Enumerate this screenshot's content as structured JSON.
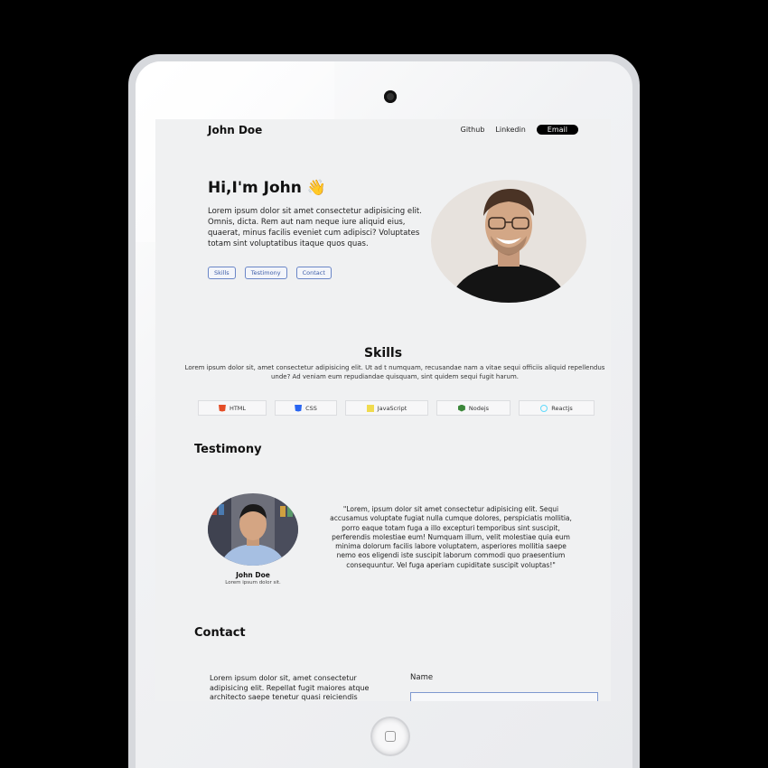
{
  "header": {
    "brand": "John Doe",
    "nav": [
      "Github",
      "Linkedin",
      "Email"
    ]
  },
  "hero": {
    "title": "Hi,I'm John 👋",
    "text": "Lorem ipsum dolor sit amet consectetur adipisicing elit. Omnis, dicta. Rem aut nam neque iure aliquid eius, quaerat, minus facilis eveniet cum adipisci? Voluptates totam sint voluptatibus itaque quos quas.",
    "buttons": [
      "Skills",
      "Testimony",
      "Contact"
    ]
  },
  "skills": {
    "title": "Skills",
    "description": "Lorem ipsum dolor sit, amet consectetur adipisicing elit. Ut ad t numquam, recusandae nam a vitae sequi officiis aliquid repellendus unde? Ad veniam eum repudiandae quisquam, sint quidem sequi fugit harum.",
    "items": [
      {
        "label": "HTML",
        "icon": "html5-icon",
        "color": "#e44d26"
      },
      {
        "label": "CSS",
        "icon": "css3-icon",
        "color": "#2965f1"
      },
      {
        "label": "JavaScript",
        "icon": "javascript-icon",
        "color": "#f0db4f"
      },
      {
        "label": "Nodejs",
        "icon": "nodejs-icon",
        "color": "#3c873a"
      },
      {
        "label": "Reactjs",
        "icon": "react-icon",
        "color": "#61dafb"
      }
    ]
  },
  "testimony": {
    "title": "Testimony",
    "name": "John Doe",
    "role": "Lorem ipsum dolor sit.",
    "quote": "\"Lorem, ipsum dolor sit amet consectetur adipisicing elit. Sequi accusamus voluptate fugiat nulla cumque dolores, perspiciatis mollitia, porro eaque totam fuga a illo excepturi temporibus sint suscipit, perferendis molestiae eum! Numquam illum, velit molestiae quia eum minima dolorum facilis labore voluptatem, asperiores mollitia saepe nemo eos eligendi iste suscipit laborum commodi quo praesentium consequuntur. Vel fuga aperiam cupiditate suscipit voluptas!\""
  },
  "contact": {
    "title": "Contact",
    "text": "Lorem ipsum dolor sit, amet consectetur adipisicing elit. Repellat fugit maiores atque architecto saepe tenetur quasi reiciendis",
    "name_label": "Name",
    "name_value": ""
  },
  "colors": {
    "accent": "#6a86c7",
    "background": "#f0f1f2",
    "device_frame": "#d7d9dd"
  }
}
